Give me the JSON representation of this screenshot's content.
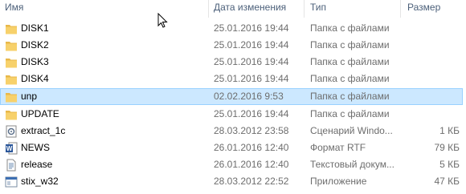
{
  "columns": {
    "name": "Имя",
    "date": "Дата изменения",
    "type": "Тип",
    "size": "Размер"
  },
  "rows": [
    {
      "name": "DISK1",
      "date": "25.01.2016 19:44",
      "type": "Папка с файлами",
      "size": "",
      "icon": "folder-icon"
    },
    {
      "name": "DISK2",
      "date": "25.01.2016 19:44",
      "type": "Папка с файлами",
      "size": "",
      "icon": "folder-icon"
    },
    {
      "name": "DISK3",
      "date": "25.01.2016 19:44",
      "type": "Папка с файлами",
      "size": "",
      "icon": "folder-icon"
    },
    {
      "name": "DISK4",
      "date": "25.01.2016 19:44",
      "type": "Папка с файлами",
      "size": "",
      "icon": "folder-icon"
    },
    {
      "name": "unp",
      "date": "02.02.2016 9:53",
      "type": "Папка с файлами",
      "size": "",
      "icon": "folder-icon",
      "selected": true
    },
    {
      "name": "UPDATE",
      "date": "25.01.2016 19:44",
      "type": "Папка с файлами",
      "size": "",
      "icon": "folder-icon"
    },
    {
      "name": "extract_1c",
      "date": "28.03.2012 23:58",
      "type": "Сценарий Windo...",
      "size": "1 КБ",
      "icon": "script-icon"
    },
    {
      "name": "NEWS",
      "date": "26.01.2016 12:40",
      "type": "Формат RTF",
      "size": "79 КБ",
      "icon": "word-doc-icon"
    },
    {
      "name": "release",
      "date": "26.01.2016 12:40",
      "type": "Текстовый докум...",
      "size": "5 КБ",
      "icon": "text-file-icon"
    },
    {
      "name": "stix_w32",
      "date": "28.03.2012 22:52",
      "type": "Приложение",
      "size": "47 КБ",
      "icon": "app-icon"
    }
  ],
  "colors": {
    "header_text": "#4c607a",
    "secondary_text": "#6d6d6d",
    "selection_bg": "#cce8ff",
    "selection_border": "#99d1ff",
    "folder": "#f7d16b"
  }
}
